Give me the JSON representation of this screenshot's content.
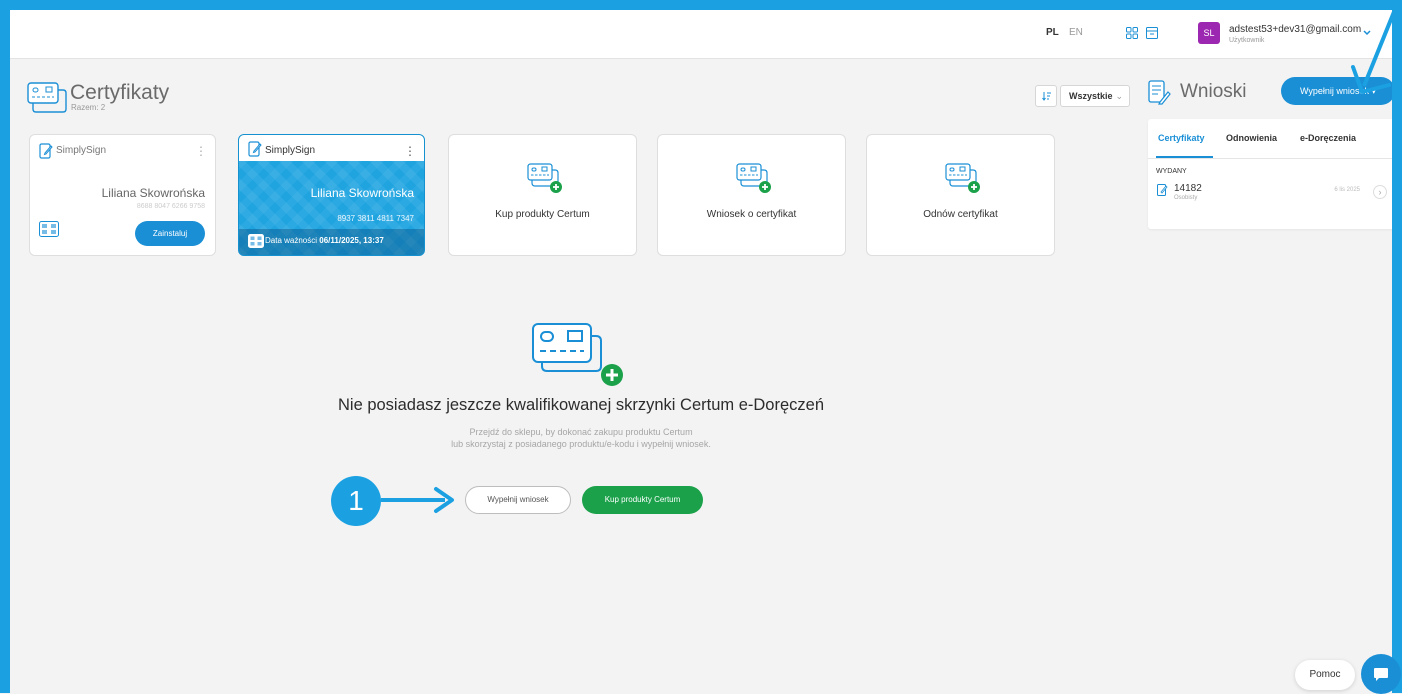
{
  "topbar": {
    "lang_pl": "PL",
    "lang_en": "EN",
    "avatar_initials": "SL",
    "user_email": "adstest53+dev31@gmail.com",
    "user_role": "Użytkownik"
  },
  "certificates": {
    "title": "Certyfikaty",
    "count_label": "Razem: 2",
    "cards": [
      {
        "brand": "SimplySign",
        "owner": "Liliana Skowrońska",
        "serial": "8688 8047 6266 9758",
        "install_label": "Zainstaluj"
      },
      {
        "brand": "SimplySign",
        "owner": "Liliana Skowrońska",
        "serial": "8937 3811 4811 7347",
        "expiry_label": "Data ważności",
        "expiry_value": "06/11/2025, 13:37"
      }
    ],
    "actions": [
      {
        "label": "Kup produkty Certum"
      },
      {
        "label": "Wniosek o certyfikat"
      },
      {
        "label": "Odnów certyfikat"
      }
    ]
  },
  "filter": {
    "selected": "Wszystkie"
  },
  "requests": {
    "title": "Wnioski",
    "fill_button": "Wypełnij wniosek",
    "tabs": [
      "Certyfikaty",
      "Odnowienia",
      "e-Doręczenia"
    ],
    "group_label": "WYDANY",
    "items": [
      {
        "number": "14182",
        "type": "Osobisty",
        "date": "6 lis 2025"
      }
    ]
  },
  "empty_state": {
    "title": "Nie posiadasz jeszcze kwalifikowanej skrzynki Certum e-Doręczeń",
    "desc_line1": "Przejdź do sklepu, by dokonać zakupu produktu Certum",
    "desc_line2": "lub skorzystaj z posiadanego produktu/e-kodu i wypełnij wniosek.",
    "fill_button": "Wypełnij wniosek",
    "buy_button": "Kup produkty Certum"
  },
  "annotation": {
    "step": "1"
  },
  "help": {
    "label": "Pomoc"
  },
  "colors": {
    "accent": "#1a8fd6",
    "frame": "#1ba1e2",
    "green": "#1aa14a",
    "avatar": "#9c27b0"
  }
}
